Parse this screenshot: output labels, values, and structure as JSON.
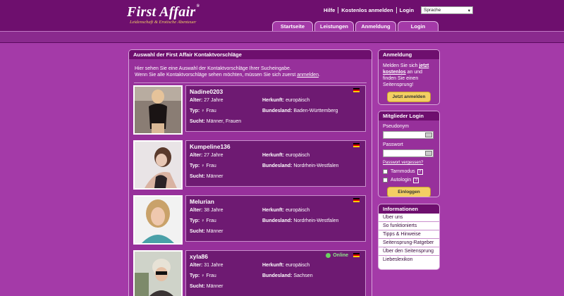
{
  "brand": {
    "title": "First Affair",
    "reg": "®",
    "subtitle": "Leidenschaft & Erotische Abenteuer"
  },
  "toplinks": {
    "hilfe": "Hilfe",
    "kostenlos": "Kostenlos anmelden",
    "login": "Login",
    "sprache": "Sprache"
  },
  "tabs": [
    "Startseite",
    "Leistungen",
    "Anmeldung",
    "Login"
  ],
  "main": {
    "heading": "Auswahl der First Affair Kontaktvorschläge",
    "intro1": "Hier sehen Sie eine Auswahl der Kontaktvorschläge Ihrer Sucheingabe.",
    "intro2": "Wenn Sie alle Kontaktvorschläge sehen möchten, müssen Sie sich zuerst ",
    "intro_link": "anmelden",
    "intro_end": "."
  },
  "labels": {
    "alter": "Alter:",
    "typ": "Typ:",
    "sucht": "Sucht:",
    "herkunft": "Herkunft:",
    "bundesland": "Bundesland:"
  },
  "profiles": [
    {
      "nick": "Nadine0203",
      "alter": "27 Jahre",
      "typ": "♀ Frau",
      "sucht": "Männer, Frauen",
      "herkunft": "europäisch",
      "bundesland": "Baden-Württemberg",
      "online": ""
    },
    {
      "nick": "Kumpeline136",
      "alter": "27 Jahre",
      "typ": "♀ Frau",
      "sucht": "Männer",
      "herkunft": "europäisch",
      "bundesland": "Nordrhein-Westfalen",
      "online": ""
    },
    {
      "nick": "Melurian",
      "alter": "38 Jahre",
      "typ": "♀ Frau",
      "sucht": "Männer",
      "herkunft": "europäisch",
      "bundesland": "Nordrhein-Westfalen",
      "online": ""
    },
    {
      "nick": "xyla86",
      "alter": "31 Jahre",
      "typ": "♀ Frau",
      "sucht": "Männer",
      "herkunft": "europäisch",
      "bundesland": "Sachsen",
      "online": "Online"
    }
  ],
  "anmeldung": {
    "heading": "Anmeldung",
    "text1": "Melden Sie sich ",
    "link": "jetzt kostenlos",
    "text2": " an und finden Sie einen Seitensprung!",
    "button": "Jetzt anmelden"
  },
  "login": {
    "heading": "Mitglieder Login",
    "pseudonym": "Pseudonym",
    "passwort": "Passwort",
    "vergessen": "Passwort vergessen?",
    "tarnmodus": "Tarnmodus",
    "autologin": "Autologin",
    "help": "?",
    "button": "Einloggen"
  },
  "informationen": {
    "heading": "Informationen",
    "items": [
      "Über uns",
      "So funktionierts",
      "Tipps & Hinweise",
      "Seitensprung-Ratgeber",
      "Über den Seitensprung",
      "Liebeslexikon"
    ]
  },
  "colors": {
    "bg": "#a43aa8",
    "dark": "#6e0f6e",
    "accent": "#f3cf63",
    "online": "#6bd160"
  }
}
